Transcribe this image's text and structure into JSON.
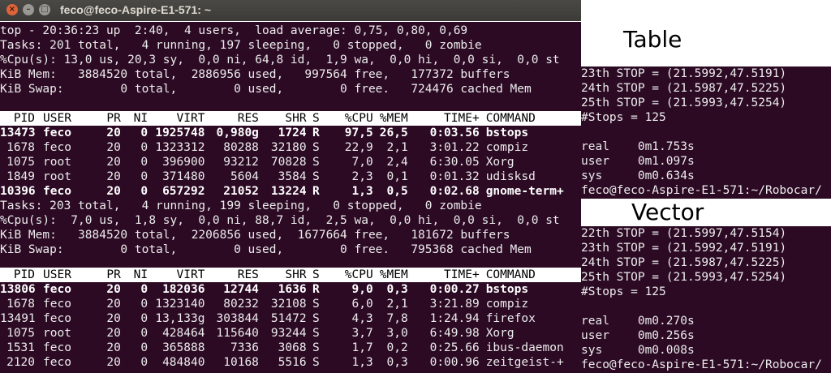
{
  "window": {
    "title": "feco@feco-Aspire-E1-571: ~",
    "close_icon": "×",
    "minimize_icon": "–",
    "maximize_icon": "□"
  },
  "columns": [
    "PID",
    "USER",
    "PR",
    "NI",
    "VIRT",
    "RES",
    "SHR",
    "S",
    "%CPU",
    "%MEM",
    "TIME+",
    "COMMAND"
  ],
  "top1": {
    "summary": [
      "top - 20:36:23 up  2:40,  4 users,  load average: 0,75, 0,80, 0,69",
      "Tasks: 201 total,   4 running, 197 sleeping,   0 stopped,   0 zombie",
      "%Cpu(s): 13,0 us, 20,3 sy,  0,0 ni, 64,8 id,  1,9 wa,  0,0 hi,  0,0 si,  0,0 st",
      "KiB Mem:   3884520 total,  2886956 used,   997564 free,   177372 buffers",
      "KiB Swap:        0 total,        0 used,        0 free.   724476 cached Mem"
    ],
    "rows": [
      [
        "13473",
        "feco",
        "20",
        "0",
        "1925748",
        "0,980g",
        "1724",
        "R",
        "97,5",
        "26,5",
        "0:03.56",
        "bstops"
      ],
      [
        "1678",
        "feco",
        "20",
        "0",
        "1323312",
        "80288",
        "32180",
        "S",
        "22,9",
        "2,1",
        "3:01.22",
        "compiz"
      ],
      [
        "1075",
        "root",
        "20",
        "0",
        "396900",
        "93212",
        "70828",
        "S",
        "7,0",
        "2,4",
        "6:30.05",
        "Xorg"
      ],
      [
        "1849",
        "root",
        "20",
        "0",
        "371480",
        "5604",
        "3584",
        "S",
        "2,3",
        "0,1",
        "0:01.32",
        "udisksd"
      ],
      [
        "10396",
        "feco",
        "20",
        "0",
        "657292",
        "21052",
        "13224",
        "R",
        "1,3",
        "0,5",
        "0:02.68",
        "gnome-term+"
      ]
    ]
  },
  "top2": {
    "summary": [
      "Tasks: 203 total,   4 running, 199 sleeping,   0 stopped,   0 zombie",
      "%Cpu(s):  7,0 us,  1,8 sy,  0,0 ni, 88,7 id,  2,5 wa,  0,0 hi,  0,0 si,  0,0 st",
      "KiB Mem:   3884520 total,  2206856 used,  1677664 free,   181672 buffers",
      "KiB Swap:        0 total,        0 used,        0 free.   795368 cached Mem"
    ],
    "rows": [
      [
        "13806",
        "feco",
        "20",
        "0",
        "182036",
        "12744",
        "1636",
        "R",
        "9,0",
        "0,3",
        "0:00.27",
        "bstops"
      ],
      [
        "1678",
        "feco",
        "20",
        "0",
        "1323140",
        "80232",
        "32108",
        "S",
        "6,0",
        "2,1",
        "3:21.89",
        "compiz"
      ],
      [
        "13491",
        "feco",
        "20",
        "0",
        "13,133g",
        "303844",
        "51472",
        "S",
        "4,3",
        "7,8",
        "1:24.94",
        "firefox"
      ],
      [
        "1075",
        "root",
        "20",
        "0",
        "428464",
        "115640",
        "93244",
        "S",
        "3,7",
        "3,0",
        "6:49.98",
        "Xorg"
      ],
      [
        "1531",
        "feco",
        "20",
        "0",
        "365888",
        "7336",
        "3068",
        "S",
        "1,7",
        "0,2",
        "0:25.66",
        "ibus-daemon"
      ],
      [
        "2120",
        "feco",
        "20",
        "0",
        "484840",
        "10168",
        "5516",
        "S",
        "1,3",
        "0,3",
        "0:00.96",
        "zeitgeist-+"
      ]
    ]
  },
  "labels": {
    "table": "Table",
    "vector": "Vector"
  },
  "right_table": [
    "23th STOP = (21.5992,47.5191)",
    "24th STOP = (21.5987,47.5225)",
    "25th STOP = (21.5993,47.5254)",
    "#Stops = 125",
    "",
    "real    0m1.753s",
    "user    0m1.097s",
    "sys     0m0.634s",
    "feco@feco-Aspire-E1-571:~/Robocar/"
  ],
  "right_vector": [
    "22th STOP = (21.5997,47.5154)",
    "23th STOP = (21.5992,47.5191)",
    "24th STOP = (21.5987,47.5225)",
    "25th STOP = (21.5993,47.5254)",
    "#Stops = 125",
    "",
    "real    0m0.270s",
    "user    0m0.256s",
    "sys     0m0.008s",
    "feco@feco-Aspire-E1-571:~/Robocar/"
  ]
}
